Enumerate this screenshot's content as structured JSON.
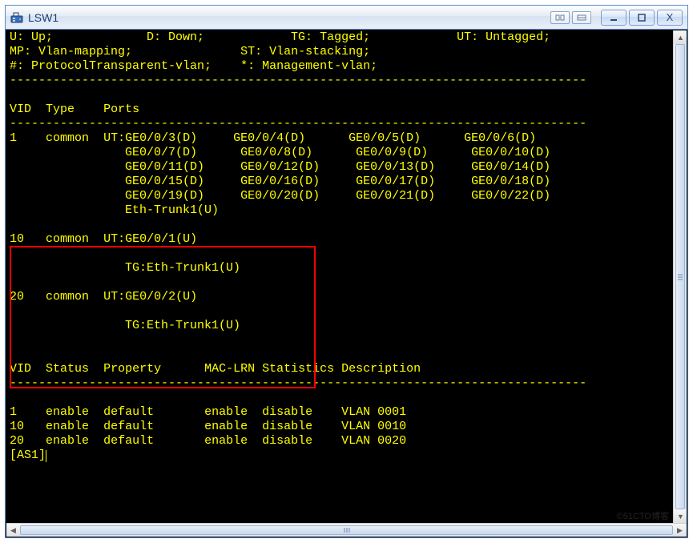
{
  "window": {
    "title": "LSW1"
  },
  "legend": {
    "line1_cut": "U: Up;             D: Down;            TG: Tagged;            UT: Untagged;",
    "l2a": "MP: Vlan-mapping;",
    "l2b": "ST: Vlan-stacking;",
    "l3a": "#: ProtocolTransparent-vlan;",
    "l3b": "*: Management-vlan;"
  },
  "hdr1": {
    "vid": "VID",
    "type": "Type",
    "ports": "Ports"
  },
  "vlan1": {
    "vid": "1",
    "type": "common",
    "r0": [
      "UT:GE0/0/3(D)",
      "GE0/0/4(D)",
      "GE0/0/5(D)",
      "GE0/0/6(D)"
    ],
    "r1": [
      "GE0/0/7(D)",
      "GE0/0/8(D)",
      "GE0/0/9(D)",
      "GE0/0/10(D)"
    ],
    "r2": [
      "GE0/0/11(D)",
      "GE0/0/12(D)",
      "GE0/0/13(D)",
      "GE0/0/14(D)"
    ],
    "r3": [
      "GE0/0/15(D)",
      "GE0/0/16(D)",
      "GE0/0/17(D)",
      "GE0/0/18(D)"
    ],
    "r4": [
      "GE0/0/19(D)",
      "GE0/0/20(D)",
      "GE0/0/21(D)",
      "GE0/0/22(D)"
    ],
    "r5": "Eth-Trunk1(U)"
  },
  "vlan10": {
    "vid": "10",
    "type": "common",
    "ut": "UT:GE0/0/1(U)",
    "tg": "TG:Eth-Trunk1(U)"
  },
  "vlan20": {
    "vid": "20",
    "type": "common",
    "ut": "UT:GE0/0/2(U)",
    "tg": "TG:Eth-Trunk1(U)"
  },
  "hdr2": {
    "vid": "VID",
    "status": "Status",
    "property": "Property",
    "mac": "MAC-LRN",
    "stat": "Statistics",
    "desc": "Description"
  },
  "status_rows": [
    {
      "vid": "1",
      "status": "enable",
      "prop": "default",
      "mac": "enable",
      "stat": "disable",
      "desc": "VLAN 0001"
    },
    {
      "vid": "10",
      "status": "enable",
      "prop": "default",
      "mac": "enable",
      "stat": "disable",
      "desc": "VLAN 0010"
    },
    {
      "vid": "20",
      "status": "enable",
      "prop": "default",
      "mac": "enable",
      "stat": "disable",
      "desc": "VLAN 0020"
    }
  ],
  "prompt": "[AS1]",
  "watermark": "©51CTO博客",
  "dash": "--------------------------------------------------------------------------------"
}
